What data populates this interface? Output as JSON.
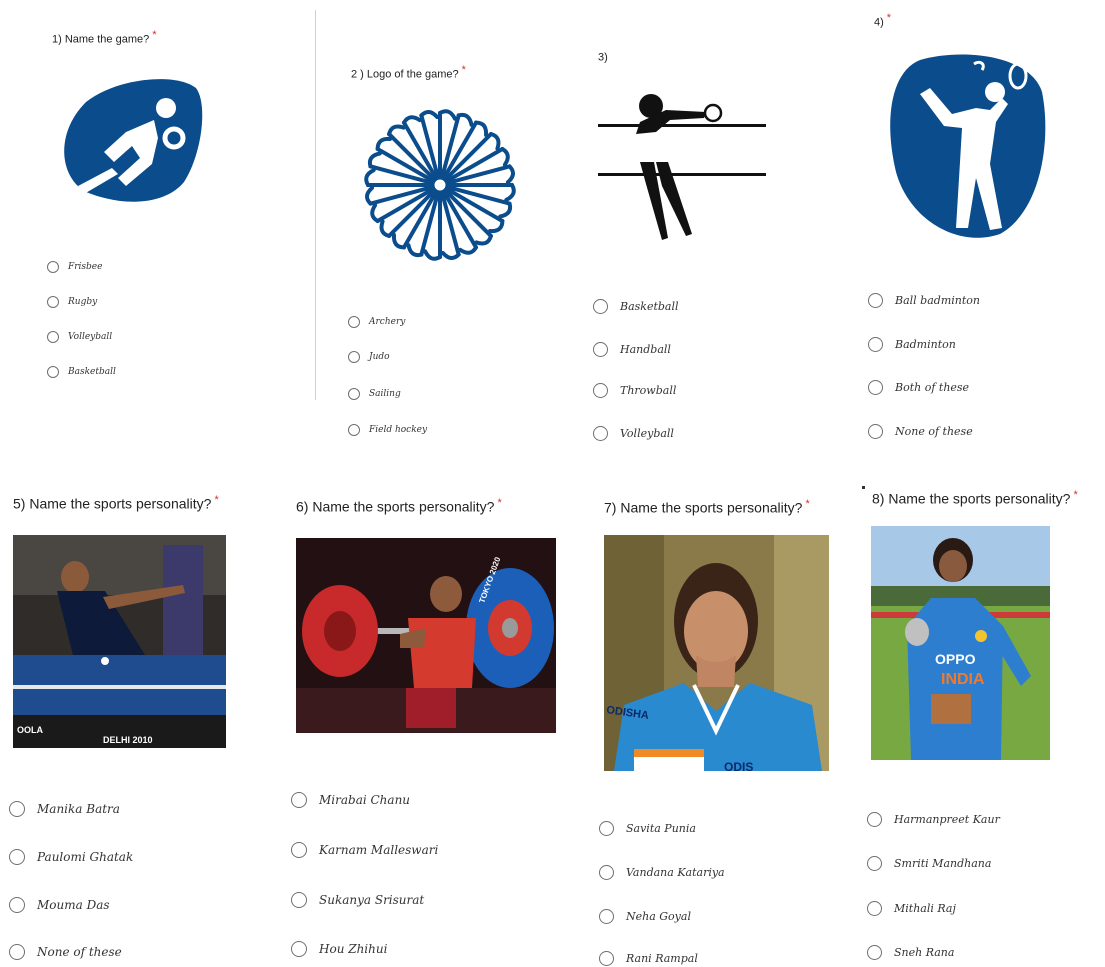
{
  "questions": [
    {
      "title": "1) Name  the game?",
      "star": "*",
      "logo": "handball-pictogram-icon",
      "options": [
        "Frisbee",
        "Rugby",
        "Volleyball",
        "Basketball"
      ]
    },
    {
      "title": "2 ) Logo of the game?",
      "star": "*",
      "logo": "wheel-logo-icon",
      "options": [
        "Archery",
        "Judo",
        "Sailing",
        "Field hockey"
      ]
    },
    {
      "title": "3)",
      "star": "",
      "logo": "volleyball-pictogram-icon",
      "options": [
        "Basketball",
        "Handball",
        "Throwball",
        "Volleyball"
      ]
    },
    {
      "title": "4)",
      "star": "*",
      "logo": "badminton-pictogram-icon",
      "options": [
        "Ball badminton",
        "Badminton",
        "Both of these",
        "None of these"
      ]
    },
    {
      "title": "5) Name the sports personality?",
      "star": "*",
      "photo": "table-tennis-player-photo",
      "photo_text": [
        "DELHI 2010",
        "OOLA"
      ],
      "options": [
        "Manika Batra",
        "Paulomi Ghatak",
        "Mouma Das",
        "None of these"
      ]
    },
    {
      "title": "6) Name the sports personality?",
      "star": "*",
      "photo": "weightlifter-photo",
      "photo_text": [
        "TOKYO 2020"
      ],
      "options": [
        "Mirabai Chanu",
        "Karnam Malleswari",
        "Sukanya Srisurat",
        "Hou Zhihui"
      ]
    },
    {
      "title": "7) Name the sports personality?",
      "star": "*",
      "photo": "hockey-player-photo",
      "photo_text": [
        "ODISHA",
        "ODIS"
      ],
      "options": [
        "Savita Punia",
        "Vandana Katariya",
        "Neha Goyal",
        "Rani Rampal"
      ]
    },
    {
      "title": "8) Name the sports personality?",
      "star": "*",
      "photo": "cricketer-photo",
      "photo_text": [
        "OPPO",
        "INDIA"
      ],
      "options": [
        "Harmanpreet Kaur",
        "Smriti Mandhana",
        "Mithali Raj",
        "Sneh Rana"
      ]
    }
  ],
  "colors": {
    "logo_blue": "#0a4c8c",
    "required_star": "#d93025",
    "radio_border": "#6f6f6f"
  }
}
